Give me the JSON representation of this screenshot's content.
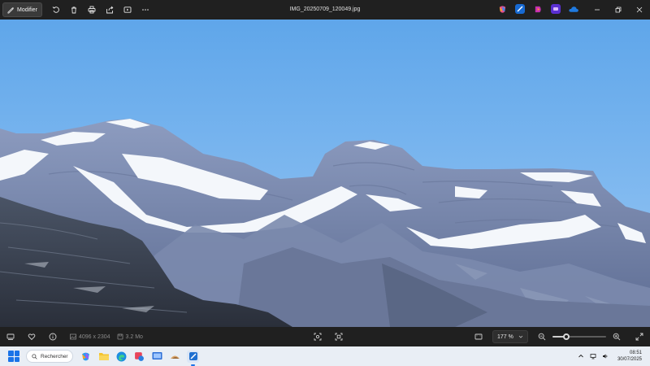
{
  "toolbar": {
    "edit_label": "Modifier",
    "icons": [
      "edit-icon",
      "rotate-icon",
      "delete-icon",
      "print-icon",
      "share-icon",
      "slideshow-icon",
      "more-icon"
    ]
  },
  "window": {
    "title": "IMG_20250709_120049.jpg",
    "pinned_apps": [
      "copilot-icon",
      "clipchamp-icon",
      "designer-icon",
      "photoshop-express-icon",
      "onedrive-icon"
    ],
    "controls": [
      "minimize-icon",
      "restore-icon",
      "close-icon"
    ]
  },
  "bottombar": {
    "dimensions": "4096 x 2304",
    "file_size": "3.2 Mo",
    "zoom": "177 %",
    "zoom_level_fraction": 0.25
  },
  "taskbar": {
    "search_label": "Rechercher",
    "apps": [
      "copilot-app-icon",
      "file-explorer-icon",
      "edge-icon",
      "snipping-tool-icon",
      "media-icon",
      "photo-editor-icon",
      "photos-icon"
    ],
    "time": "08:51",
    "date": "30/07/2025"
  },
  "colors": {
    "sky_top": "#5fa6ea",
    "sky_bottom": "#9ac8f4",
    "accent": "#1a73e8"
  }
}
